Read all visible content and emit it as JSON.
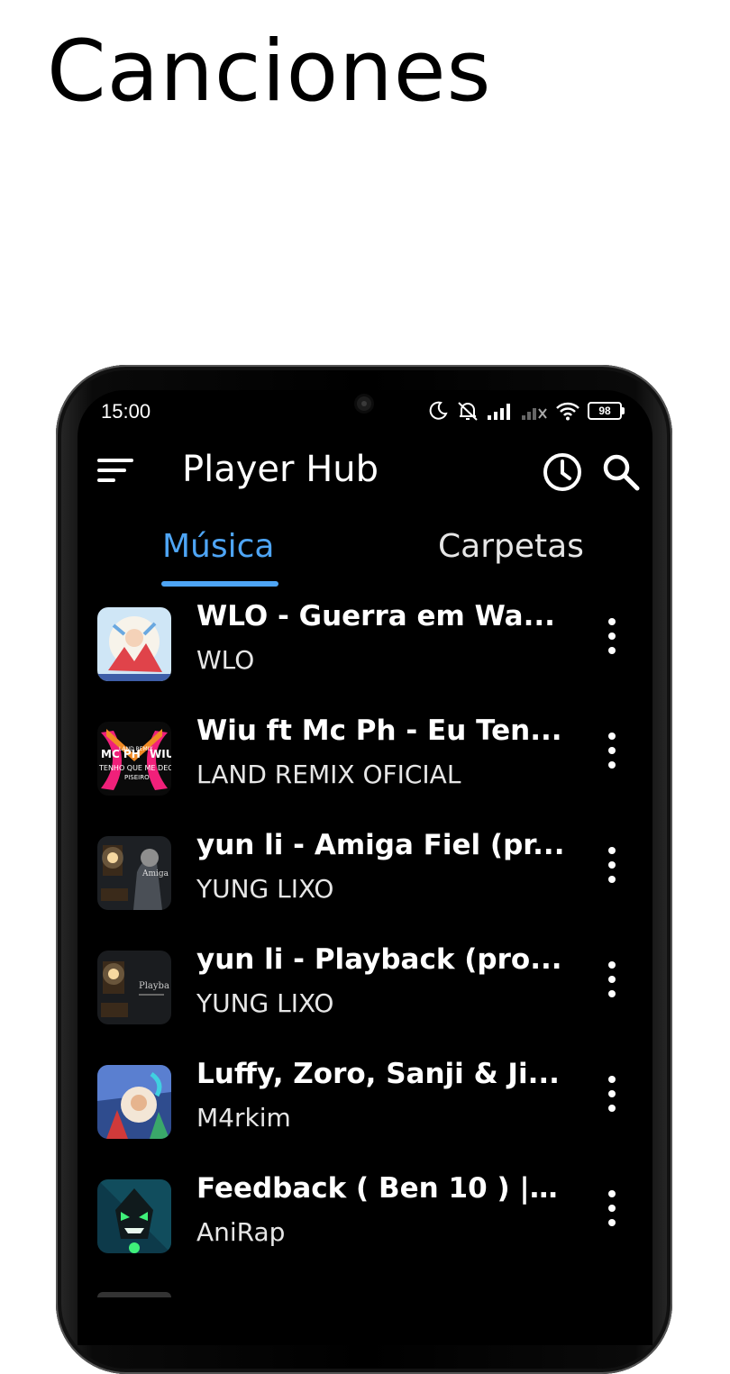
{
  "headline": "Canciones",
  "status_bar": {
    "time": "15:00",
    "battery": "98"
  },
  "app_bar": {
    "title": "Player Hub",
    "icons": [
      "menu-icon",
      "history-icon",
      "search-icon"
    ]
  },
  "tabs": [
    {
      "label": "Música",
      "selected": true
    },
    {
      "label": "Carpetas",
      "selected": false
    }
  ],
  "colors": {
    "accent": "#4ea5f5",
    "background": "#000000",
    "text": "#ffffff"
  },
  "songs": [
    {
      "title": "WLO - Guerra em Wa...",
      "artist": "WLO"
    },
    {
      "title": "Wiu ft Mc Ph - Eu Ten...",
      "artist": "LAND REMIX OFICIAL",
      "art_text": [
        "MC PH",
        "WIU",
        "LAND REMIX",
        "TENHO QUE ME DECI",
        "PISEIRO"
      ]
    },
    {
      "title": "yun li - Amiga Fiel (pr...",
      "artist": "YUNG LIXO",
      "art_text": [
        "Amiga"
      ]
    },
    {
      "title": "yun li - Playback (pro...",
      "artist": "YUNG LIXO",
      "art_text": [
        "Playba"
      ]
    },
    {
      "title": "Luffy, Zoro, Sanji & Ji...",
      "artist": "M4rkim"
    },
    {
      "title": "Feedback ( Ben 10 ) | ...",
      "artist": "AniRap"
    }
  ]
}
